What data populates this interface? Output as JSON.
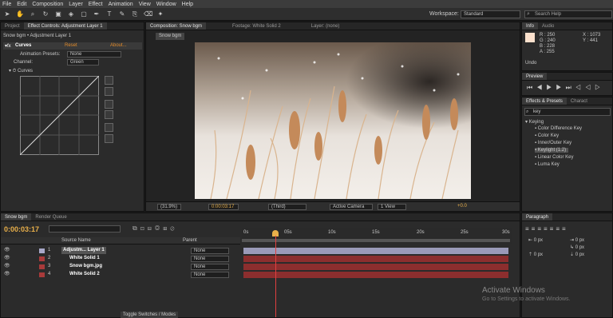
{
  "menu": [
    "File",
    "Edit",
    "Composition",
    "Layer",
    "Effect",
    "Animation",
    "View",
    "Window",
    "Help"
  ],
  "workspace": {
    "label": "Workspace:",
    "value": "Standard"
  },
  "search": {
    "placeholder": "Search Help"
  },
  "left_panel": {
    "tabs": [
      "Project",
      "Effect Controls: Adjustment Layer 1"
    ],
    "breadcrumb": "Snow bgm • Adjustment Layer 1",
    "effect": {
      "name": "Curves",
      "reset": "Reset",
      "about": "About...",
      "preset_label": "Animation Presets:",
      "preset_value": "None",
      "channel_label": "Channel:",
      "channel_value": "Green",
      "curves_label": "Curves"
    }
  },
  "comp_panel": {
    "tabs": [
      "Composition: Snow bgm",
      "Footage: White Solid 2",
      "Layer: (none)"
    ],
    "comp_name": "Snow bgm",
    "footer": {
      "zoom": "(31.9%)",
      "timecode": "0:00:03:17",
      "resolution": "(Third)",
      "camera": "Active Camera",
      "views": "1 View",
      "exposure": "+0.0"
    }
  },
  "info_panel": {
    "tabs": [
      "Info",
      "Audio"
    ],
    "r": "R : 250",
    "g": "G : 240",
    "b": "B : 228",
    "a": "A : 255",
    "x": "X : 1073",
    "y": "Y : 441",
    "undo": "Undo",
    "swatch": "#fae0cc"
  },
  "preview_panel": {
    "title": "Preview"
  },
  "effects_panel": {
    "tabs": [
      "Effects & Presets",
      "Charact"
    ],
    "search_value": "key",
    "category": "Keying",
    "items": [
      "Color Difference Key",
      "Color Key",
      "Inner/Outer Key",
      "Keylight (1.2)",
      "Linear Color Key",
      "Luma Key"
    ]
  },
  "timeline": {
    "tabs": [
      "Snow bgm",
      "Render Queue"
    ],
    "timecode": "0:00:03:17",
    "columns": {
      "source": "Source Name",
      "parent": "Parent"
    },
    "ruler": [
      "0s",
      "05s",
      "10s",
      "15s",
      "20s",
      "25s",
      "30s"
    ],
    "layers": [
      {
        "num": "1",
        "name": "Adjustm... Layer 1",
        "parent": "None",
        "color": "#a8a8c8"
      },
      {
        "num": "2",
        "name": "White Solid 1",
        "parent": "None",
        "color": "#a83a3a"
      },
      {
        "num": "3",
        "name": "Snow bgm.jpg",
        "parent": "None",
        "color": "#a83a3a"
      },
      {
        "num": "4",
        "name": "White Solid 2",
        "parent": "None",
        "color": "#a83a3a"
      }
    ],
    "toggle_label": "Toggle Switches / Modes"
  },
  "paragraph_panel": {
    "tabs": [
      "Paragraph"
    ],
    "values": [
      "0 px",
      "0 px",
      "0 px",
      "0 px",
      "0 px"
    ]
  },
  "watermark": {
    "title": "Activate Windows",
    "subtitle": "Go to Settings to activate Windows."
  }
}
